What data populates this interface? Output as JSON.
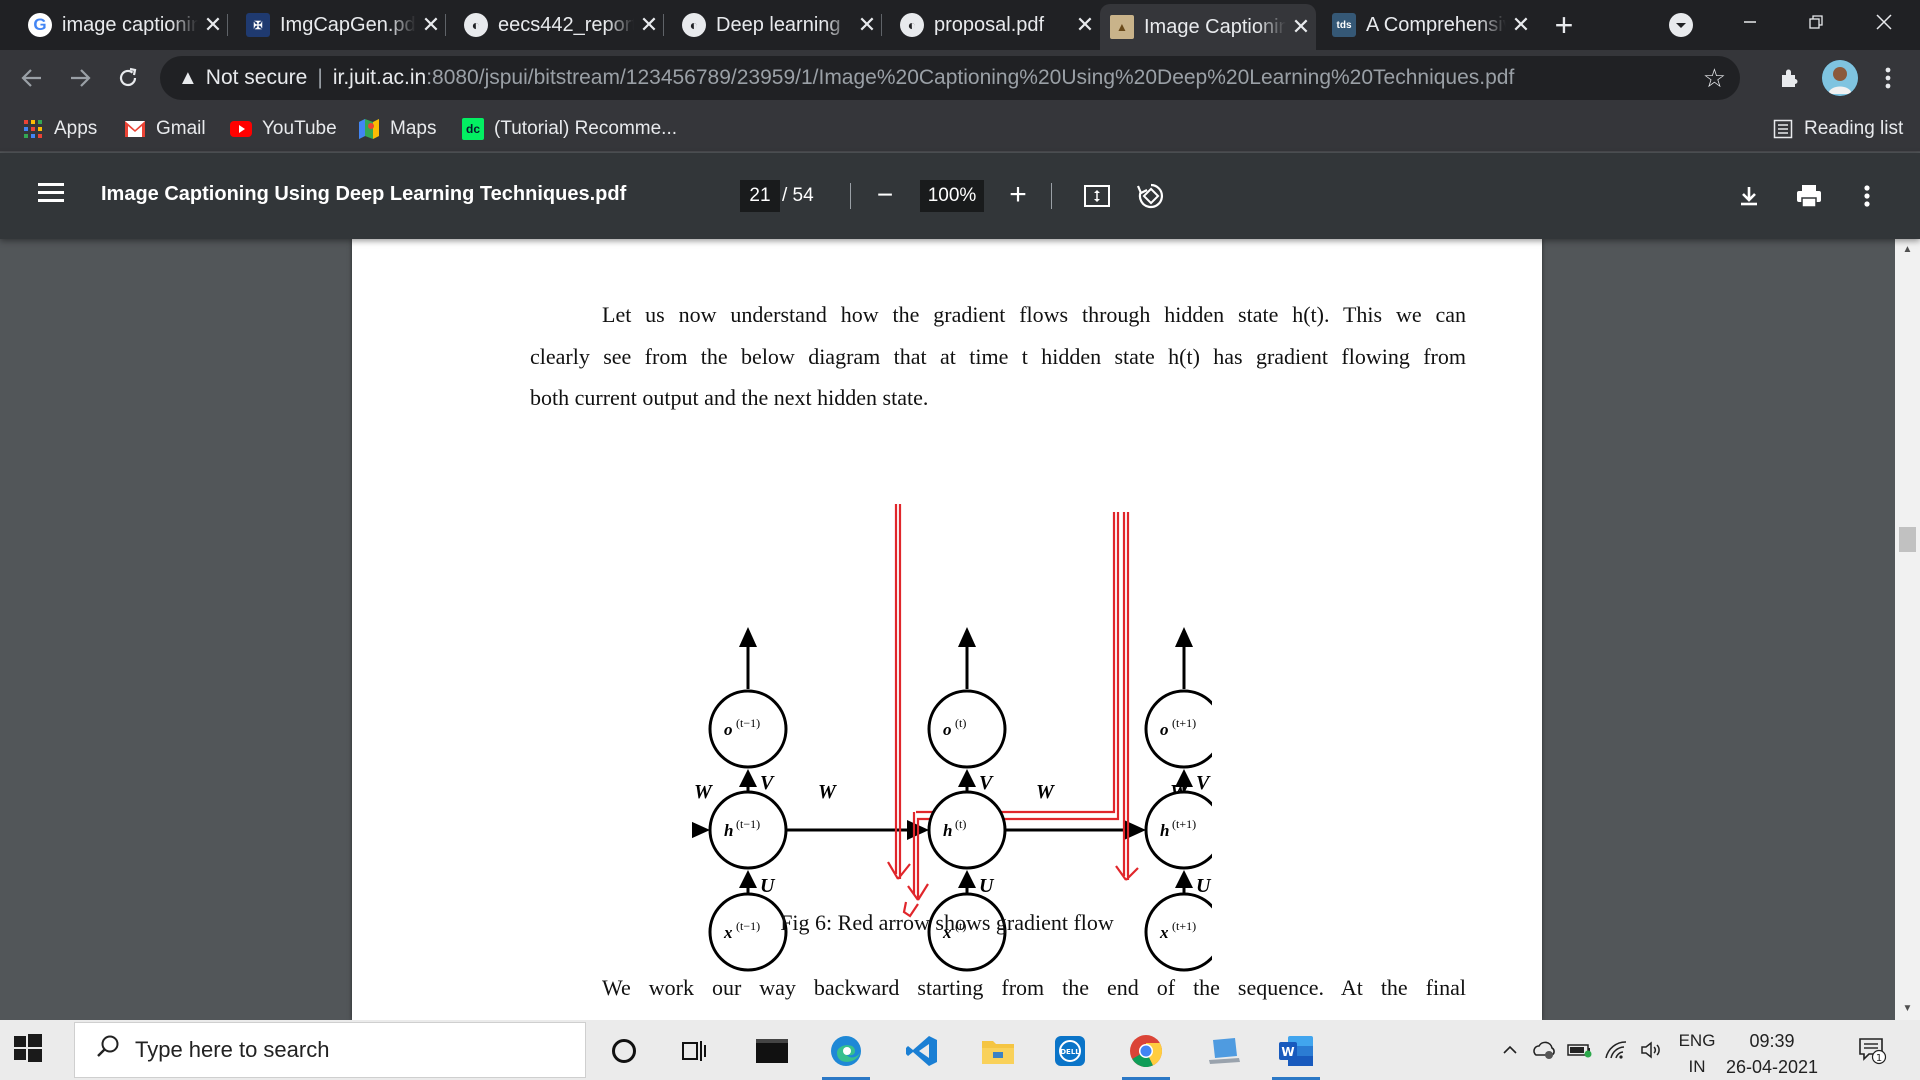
{
  "tabs": [
    {
      "title": "image captioning",
      "favicon": "google-icon",
      "active": false
    },
    {
      "title": "ImgCapGen.pdf",
      "favicon": "university-crest-icon",
      "active": false
    },
    {
      "title": "eecs442_report",
      "favicon": "globe-icon",
      "active": false
    },
    {
      "title": "Deep learning",
      "favicon": "globe-icon",
      "active": false
    },
    {
      "title": "proposal.pdf",
      "favicon": "globe-icon",
      "active": false
    },
    {
      "title": "Image Captioning",
      "favicon": "image-icon",
      "active": true
    },
    {
      "title": "A Comprehensive",
      "favicon": "tds-icon",
      "favicon_text": "tds",
      "active": false
    }
  ],
  "address_bar": {
    "security_label": "Not secure",
    "host": "ir.juit.ac.in",
    "path": ":8080/jspui/bitstream/123456789/23959/1/Image%20Captioning%20Using%20Deep%20Learning%20Techniques.pdf"
  },
  "bookmarks": [
    {
      "label": "Apps",
      "icon": "apps-grid-icon"
    },
    {
      "label": "Gmail",
      "icon": "gmail-icon"
    },
    {
      "label": "YouTube",
      "icon": "youtube-icon"
    },
    {
      "label": "Maps",
      "icon": "maps-icon"
    },
    {
      "label": "(Tutorial) Recomme...",
      "icon": "datacamp-icon"
    }
  ],
  "reading_list_label": "Reading list",
  "pdf_viewer": {
    "file_name": "Image Captioning Using Deep Learning Techniques.pdf",
    "current_page": "21",
    "total_pages": "/ 54",
    "zoom": "100%"
  },
  "document": {
    "paragraph1": [
      "Let us now understand how the gradient flows through hidden state h(t). This we can",
      "clearly see from the below diagram that at time t  hidden state h(t) has gradient flowing from",
      "both current output and the next hidden state."
    ],
    "figure_caption": "Fig 6: Red arrow shows gradient flow",
    "paragraph2_line1": "We work our way backward   starting from the end of the sequence. At the final",
    "diagram": {
      "output_nodes": [
        "o",
        "o",
        "o"
      ],
      "hidden_nodes": [
        "h",
        "h",
        "h"
      ],
      "input_nodes": [
        "x",
        "x",
        "x"
      ],
      "superscripts": [
        "(t−1)",
        "(t)",
        "(t+1)"
      ],
      "weight_labels": {
        "recurrent": "W",
        "output": "V",
        "input": "U"
      },
      "gradient_color": "#e0262b"
    }
  },
  "taskbar": {
    "search_placeholder": "Type here to search",
    "language_top": "ENG",
    "language_bottom": "IN",
    "time": "09:39",
    "date": "26-04-2021",
    "notification_count": "1"
  }
}
